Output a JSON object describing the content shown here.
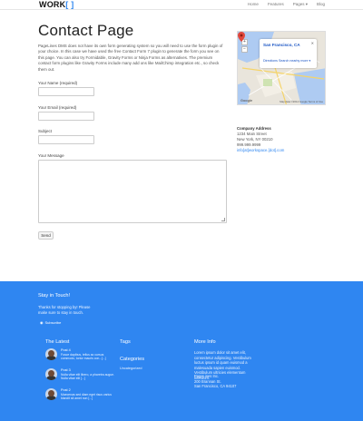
{
  "nav": {
    "logo_text": "WORK",
    "logo_brackets": "[ ]",
    "links": [
      "Home",
      "Features",
      "Pages ▾",
      "Blog"
    ]
  },
  "page": {
    "title": "Contact Page",
    "intro": "PageLines DMS does not have its own form generating system so you will need to use the form plugin of your choice. In this case we have used the free Contact Form 7 plugin to generate the form you see on this page. You can also try Formidable, Gravity Forms or Ninja Forms as alternatives. The premium contact form plugins like Gravity Forms include many add ons like MailChimp integration etc., so check them out."
  },
  "form": {
    "name_label": "Your Name (required)",
    "email_label": "Your Email (required)",
    "subject_label": "Subject",
    "message_label": "Your Message",
    "send_label": "Send"
  },
  "map": {
    "city": "San Francisco, CA",
    "links": "Directions   Search nearby   more ▾",
    "google": "Google",
    "terms": "Map data ©2014 Google  Terms of Use"
  },
  "address": {
    "heading": "Company Address",
    "street": "1234 Main Street",
    "city": "New York, NY 00210",
    "phone": "999.999.9999",
    "email": "info[at]workspace.[dot].com"
  },
  "footer": {
    "stay_title": "Stay in Touch!",
    "stay_text": "Thanks for stopping by! Please make sure to stay in touch.",
    "subscribe": "Subscribe",
    "latest_title": "The Latest",
    "posts": [
      {
        "title": "Post 4",
        "text": "Fusce dapibus, tellus ac cursus commodo, tortor mauris con...[...]"
      },
      {
        "title": "Post 3",
        "text": "Nulla vitae elit libero, a pharetra augue. Nulla vitae elit [...]"
      },
      {
        "title": "Post 2",
        "text": "Maecenas sed diam eget risus varius blandit sit amet non [...]"
      }
    ],
    "tags_title": "Tags",
    "categories_title": "Categories",
    "category_item": "Uncategorized",
    "more_title": "More Info",
    "more_text": "Lorem ipsum dolor sit amet elit, consectetur adipiscing. Vestibulum luctus ipsum id quam euismod a malesuada sapien euismod. Vestibulum ultricies elementum interdum.",
    "addr_lines": [
      "PageLines Inc.",
      "200 Brannan St.",
      "San Francisco, CA 94107"
    ]
  },
  "colors": {
    "accent": "#2e86f0",
    "footer_bg": "#2f86f1"
  }
}
